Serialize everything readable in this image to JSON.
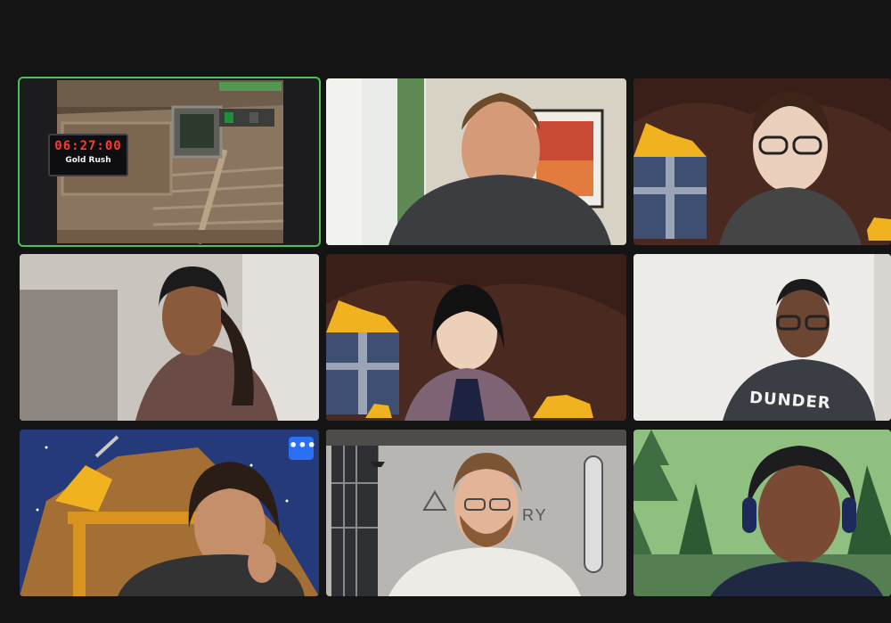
{
  "meeting": {
    "layout": "gallery-3x3",
    "accent_color": "#49c35a",
    "menu_button_color": "#2b6ff2"
  },
  "tiles": [
    {
      "id": "tile-1",
      "background": "escape-room-camera",
      "active_speaker": true
    },
    {
      "id": "tile-2",
      "background": "home-window-painting"
    },
    {
      "id": "tile-3",
      "background": "gold-mine-cart"
    },
    {
      "id": "tile-4",
      "background": "blurred-room"
    },
    {
      "id": "tile-5",
      "background": "gold-mine-cart"
    },
    {
      "id": "tile-6",
      "background": "white-wall"
    },
    {
      "id": "tile-7",
      "background": "gold-mine-night",
      "menu_button": true
    },
    {
      "id": "tile-8",
      "background": "industrial-loft"
    },
    {
      "id": "tile-9",
      "background": "pine-forest"
    }
  ],
  "game_screen": {
    "timer": "06:27:00",
    "title": "Gold Rush",
    "lock_icon": "lock-icon"
  },
  "more_button": {
    "label": "•••",
    "icon": "ellipsis-icon"
  },
  "shirt": {
    "text": "DUNDER"
  },
  "wall_sign": {
    "text": "RY"
  }
}
